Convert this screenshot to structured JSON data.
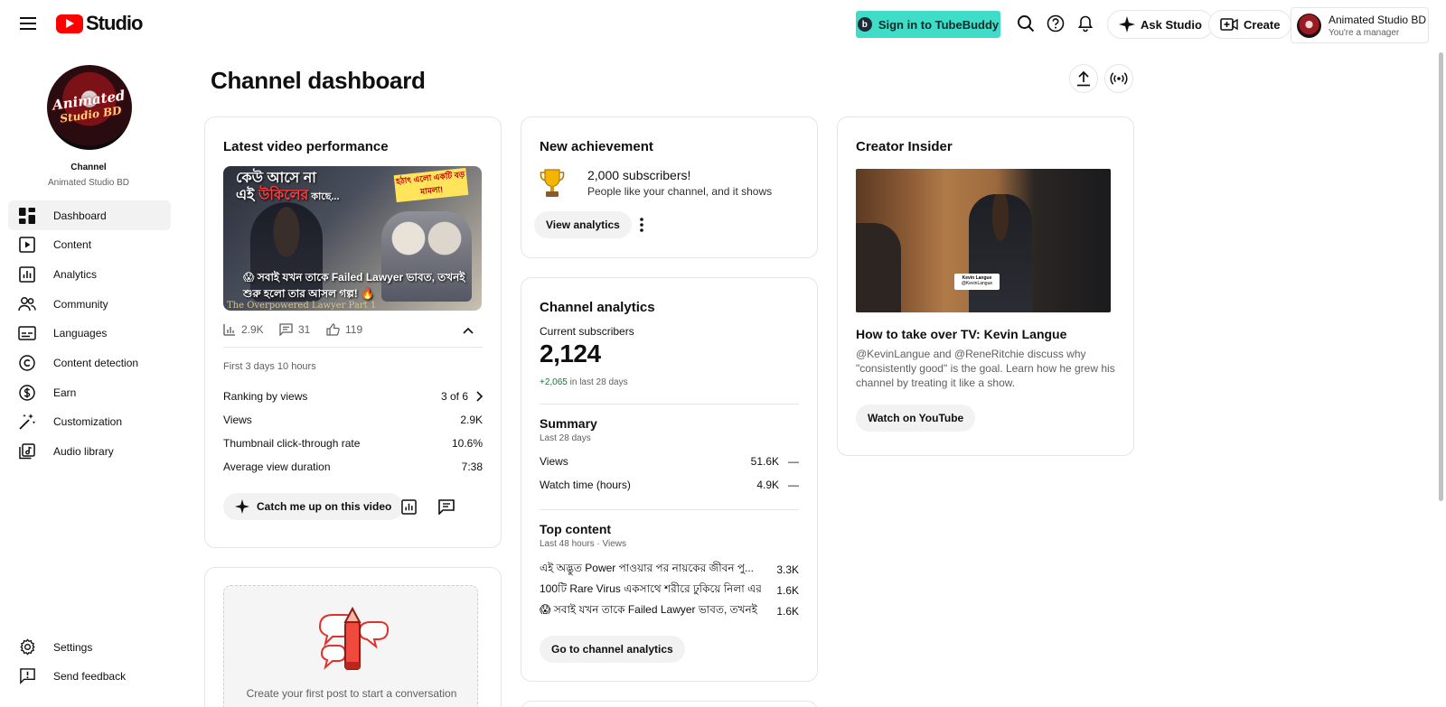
{
  "header": {
    "logo_text": "Studio",
    "tubebuddy_label": "Sign in to TubeBuddy",
    "ask_studio_label": "Ask Studio",
    "create_label": "Create",
    "account_name": "Animated Studio BD",
    "account_role": "You're a manager"
  },
  "sidebar": {
    "avatar_text_line1": "Animated",
    "avatar_text_line2": "Studio BD",
    "channel_label": "Channel",
    "channel_name": "Animated Studio BD",
    "items": [
      {
        "label": "Dashboard",
        "icon": "dashboard-icon",
        "active": true
      },
      {
        "label": "Content",
        "icon": "content-icon"
      },
      {
        "label": "Analytics",
        "icon": "analytics-icon"
      },
      {
        "label": "Community",
        "icon": "community-icon"
      },
      {
        "label": "Languages",
        "icon": "languages-icon"
      },
      {
        "label": "Content detection",
        "icon": "copyright-icon"
      },
      {
        "label": "Earn",
        "icon": "dollar-icon"
      },
      {
        "label": "Customization",
        "icon": "magic-wand-icon"
      },
      {
        "label": "Audio library",
        "icon": "audio-library-icon"
      }
    ],
    "bottom_items": [
      {
        "label": "Settings",
        "icon": "gear-icon"
      },
      {
        "label": "Send feedback",
        "icon": "feedback-icon"
      }
    ]
  },
  "main": {
    "title": "Channel dashboard"
  },
  "latest_video": {
    "title": "Latest video performance",
    "thumb_top_line1": "কেউ আসে না",
    "thumb_top_line2_a": "এই ",
    "thumb_top_line2_b": "উকিলের",
    "thumb_top_line2_c": " কাছে...",
    "thumb_badge": "হঠাৎ এলো একটি বড় মামলা!",
    "thumb_caption": "😱 সবাই যখন তাকে Failed Lawyer ভাবত, তখনই শুরু হলো তার আসল গল্প! 🔥",
    "thumb_watermark": "The Overpowered Lawyer Part 1",
    "views_stat": "2.9K",
    "comments_stat": "31",
    "likes_stat": "119",
    "period": "First 3 days 10 hours",
    "rows": [
      {
        "label": "Ranking by views",
        "value": "3 of 6"
      },
      {
        "label": "Views",
        "value": "2.9K"
      },
      {
        "label": "Thumbnail click-through rate",
        "value": "10.6%"
      },
      {
        "label": "Average view duration",
        "value": "7:38"
      }
    ],
    "catch_up_label": "Catch me up on this video"
  },
  "post_card": {
    "text": "Create your first post to start a conversation"
  },
  "achievement": {
    "title": "New achievement",
    "headline": "2,000 subscribers!",
    "sub": "People like your channel, and it shows",
    "button": "View analytics"
  },
  "channel_analytics": {
    "title": "Channel analytics",
    "subs_label": "Current subscribers",
    "subs_value": "2,124",
    "subs_delta": "+2,065",
    "subs_delta_suffix": " in last 28 days",
    "summary_title": "Summary",
    "summary_period": "Last 28 days",
    "summary_rows": [
      {
        "label": "Views",
        "value": "51.6K",
        "trend": "—"
      },
      {
        "label": "Watch time (hours)",
        "value": "4.9K",
        "trend": "—"
      }
    ],
    "top_title": "Top content",
    "top_period": "Last 48 hours · Views",
    "top_rows": [
      {
        "label": "এই অদ্ভুত Power পাওয়ার পর নায়কের জীবন পু...",
        "value": "3.3K"
      },
      {
        "label": "100টি Rare Virus একসাথে শরীরে ঢুকিয়ে নিলা এর...",
        "value": "1.6K"
      },
      {
        "label": "😱 সবাই যখন তাকে Failed Lawyer ভাবত, তখনই ...",
        "value": "1.6K"
      }
    ],
    "button": "Go to channel analytics"
  },
  "creator_insider": {
    "title": "Creator Insider",
    "video_title": "How to take over TV: Kevin Langue",
    "tag_name": "Kevin Langue",
    "tag_handle": "@KevinLangue",
    "description": "@KevinLangue and @ReneRitchie discuss why \"consistently good\" is the goal. Learn how he grew his channel by treating it like a show.",
    "button": "Watch on YouTube"
  },
  "colors": {
    "brand_red": "#ff0000",
    "tubebuddy": "#3fdcc8",
    "positive_green": "#0f7b2e"
  }
}
